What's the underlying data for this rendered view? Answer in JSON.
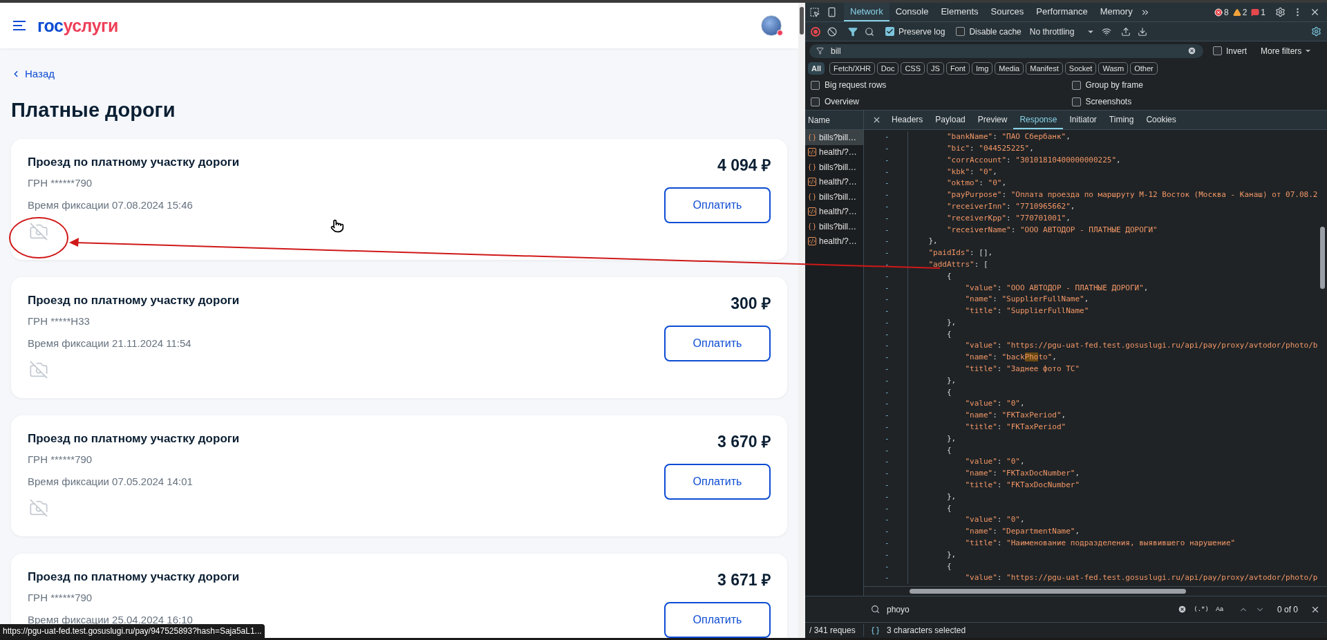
{
  "page": {
    "logo_part_1": "гос",
    "logo_part_2": "услуги",
    "back_link": "Назад",
    "title": "Платные дороги",
    "bills": [
      {
        "title": "Проезд по платному участку дороги",
        "grn": "ГРН ******790",
        "time": "Время фиксации 07.08.2024 15:46",
        "amount": "4 094 ₽",
        "button": "Оплатить"
      },
      {
        "title": "Проезд по платному участку дороги",
        "grn": "ГРН *****Н33",
        "time": "Время фиксации 21.11.2024 11:54",
        "amount": "300 ₽",
        "button": "Оплатить"
      },
      {
        "title": "Проезд по платному участку дороги",
        "grn": "ГРН ******790",
        "time": "Время фиксации 07.05.2024 14:01",
        "amount": "3 670 ₽",
        "button": "Оплатить"
      },
      {
        "title": "Проезд по платному участку дороги",
        "grn": "ГРН ******790",
        "time": "Время фиксации 25.04.2024 16:10",
        "amount": "3 671 ₽",
        "button": "Оплатить"
      }
    ],
    "status_url": "https://pgu-uat-fed.test.gosuslugi.ru/pay/947525893?hash=Saja5aL1..."
  },
  "devtools": {
    "tabs": [
      {
        "label": "Network",
        "selected": true
      },
      {
        "label": "Console",
        "selected": false
      },
      {
        "label": "Elements",
        "selected": false
      },
      {
        "label": "Sources",
        "selected": false
      },
      {
        "label": "Performance",
        "selected": false
      },
      {
        "label": "Memory",
        "selected": false
      }
    ],
    "counts": {
      "errors": "8",
      "warnings": "2",
      "issues": "1"
    },
    "preserve_log": {
      "label": "Preserve log",
      "checked": true
    },
    "disable_cache": {
      "label": "Disable cache",
      "checked": false
    },
    "throttling": "No throttling",
    "filter": {
      "value": "bill",
      "invert": {
        "label": "Invert",
        "checked": false
      },
      "more_filters": "More filters"
    },
    "type_chips": [
      {
        "label": "All",
        "selected": true
      },
      {
        "label": "Fetch/XHR",
        "selected": false
      },
      {
        "label": "Doc",
        "selected": false
      },
      {
        "label": "CSS",
        "selected": false
      },
      {
        "label": "JS",
        "selected": false
      },
      {
        "label": "Font",
        "selected": false
      },
      {
        "label": "Img",
        "selected": false
      },
      {
        "label": "Media",
        "selected": false
      },
      {
        "label": "Manifest",
        "selected": false
      },
      {
        "label": "Socket",
        "selected": false
      },
      {
        "label": "Wasm",
        "selected": false
      },
      {
        "label": "Other",
        "selected": false
      }
    ],
    "options": [
      {
        "label": "Big request rows",
        "checked": false
      },
      {
        "label": "Group by frame",
        "checked": false
      },
      {
        "label": "Overview",
        "checked": false
      },
      {
        "label": "Screenshots",
        "checked": false
      }
    ],
    "name_header": "Name",
    "detail_tabs": [
      {
        "label": "Headers",
        "selected": false
      },
      {
        "label": "Payload",
        "selected": false
      },
      {
        "label": "Preview",
        "selected": false
      },
      {
        "label": "Response",
        "selected": true
      },
      {
        "label": "Initiator",
        "selected": false
      },
      {
        "label": "Timing",
        "selected": false
      },
      {
        "label": "Cookies",
        "selected": false
      }
    ],
    "requests": [
      {
        "name": "bills?bill…",
        "kind": "fetch",
        "selected": true
      },
      {
        "name": "health/?…",
        "kind": "doc",
        "selected": false
      },
      {
        "name": "bills?bill…",
        "kind": "fetch",
        "selected": false
      },
      {
        "name": "health/?…",
        "kind": "doc",
        "selected": false
      },
      {
        "name": "bills?bill…",
        "kind": "fetch",
        "selected": false
      },
      {
        "name": "health/?…",
        "kind": "doc",
        "selected": false
      },
      {
        "name": "bills?bill…",
        "kind": "fetch",
        "selected": false
      },
      {
        "name": "health/?…",
        "kind": "doc",
        "selected": false
      }
    ],
    "code_lines": [
      {
        "mark": "-",
        "text": "        \"bankName\": \"ПАО Сбербанк\","
      },
      {
        "mark": "-",
        "text": "        \"bic\": \"044525225\","
      },
      {
        "mark": "-",
        "text": "        \"corrAccount\": \"30101810400000000225\","
      },
      {
        "mark": "-",
        "text": "        \"kbk\": \"0\","
      },
      {
        "mark": "-",
        "text": "        \"oktmo\": \"0\","
      },
      {
        "mark": "-",
        "text": "        \"payPurpose\": \"Оплата проезда по маршруту М-12 Восток (Москва - Канаш) от 07.08.2"
      },
      {
        "mark": "-",
        "text": "        \"receiverInn\": \"7710965662\","
      },
      {
        "mark": "-",
        "text": "        \"receiverKpp\": \"770701001\","
      },
      {
        "mark": "-",
        "text": "        \"receiverName\": \"ООО АВТОДОР - ПЛАТНЫЕ ДОРОГИ\""
      },
      {
        "mark": "-",
        "text": "    },"
      },
      {
        "mark": "-",
        "text": "    \"paidIds\": [],"
      },
      {
        "mark": "-",
        "text": "    \"addAttrs\": ["
      },
      {
        "mark": "-",
        "text": "        {"
      },
      {
        "mark": "-",
        "text": "            \"value\": \"ООО АВТОДОР - ПЛАТНЫЕ ДОРОГИ\","
      },
      {
        "mark": "-",
        "text": "            \"name\": \"SupplierFullName\","
      },
      {
        "mark": "-",
        "text": "            \"title\": \"SupplierFullName\""
      },
      {
        "mark": "-",
        "text": "        },"
      },
      {
        "mark": "-",
        "text": "        {"
      },
      {
        "mark": "-",
        "text": "            \"value\": \"https://pgu-uat-fed.test.gosuslugi.ru/api/pay/proxy/avtodor/photo/b"
      },
      {
        "mark": "-",
        "text": "            \"name\": \"back",
        "match": "Pho",
        "after": "to\","
      },
      {
        "mark": "-",
        "text": "            \"title\": \"Заднее фото ТС\""
      },
      {
        "mark": "-",
        "text": "        },"
      },
      {
        "mark": "-",
        "text": "        {"
      },
      {
        "mark": "-",
        "text": "            \"value\": \"0\","
      },
      {
        "mark": "-",
        "text": "            \"name\": \"FKTaxPeriod\","
      },
      {
        "mark": "-",
        "text": "            \"title\": \"FKTaxPeriod\""
      },
      {
        "mark": "-",
        "text": "        },"
      },
      {
        "mark": "-",
        "text": "        {"
      },
      {
        "mark": "-",
        "text": "            \"value\": \"0\","
      },
      {
        "mark": "-",
        "text": "            \"name\": \"FKTaxDocNumber\","
      },
      {
        "mark": "-",
        "text": "            \"title\": \"FKTaxDocNumber\""
      },
      {
        "mark": "-",
        "text": "        },"
      },
      {
        "mark": "-",
        "text": "        {"
      },
      {
        "mark": "-",
        "text": "            \"value\": \"0\","
      },
      {
        "mark": "-",
        "text": "            \"name\": \"DepartmentName\","
      },
      {
        "mark": "-",
        "text": "            \"title\": \"Наименование подразделения, выявившего нарушение\""
      },
      {
        "mark": "-",
        "text": "        },"
      },
      {
        "mark": "-",
        "text": "        {"
      },
      {
        "mark": "-",
        "text": "            \"value\": \"https://pgu-uat-fed.test.gosuslugi.ru/api/pay/proxy/avtodor/photo/p"
      }
    ],
    "search": {
      "value": "phoyo",
      "regex": "(.*)",
      "case": "Aa",
      "result": "0 of 0"
    },
    "status": {
      "requests": "/ 341 reques",
      "selection": "3 characters selected"
    }
  }
}
